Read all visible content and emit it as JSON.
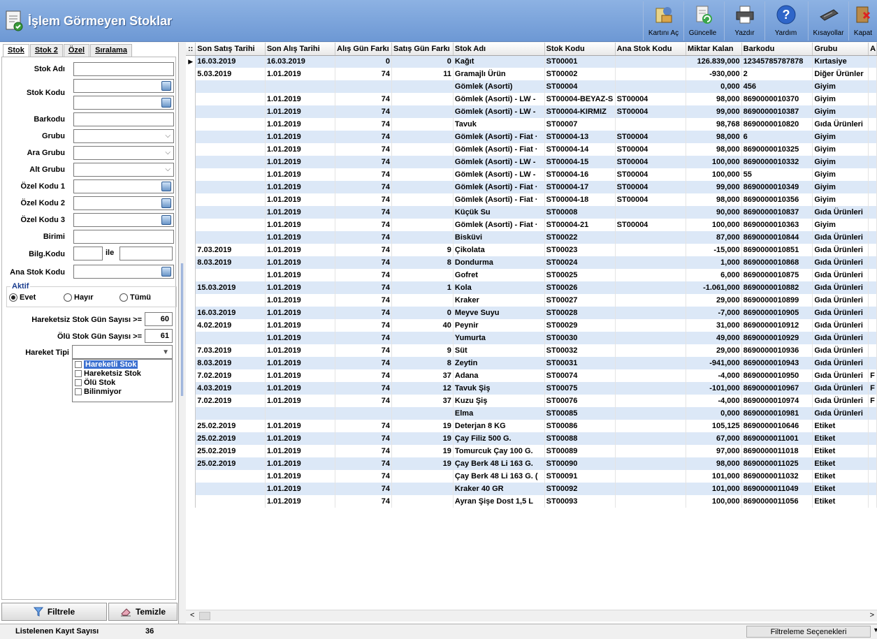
{
  "window": {
    "title": "İşlem Görmeyen Stoklar"
  },
  "toolbar": [
    {
      "label": "Kartını Aç",
      "icon": "card-open-icon"
    },
    {
      "label": "Güncelle",
      "icon": "refresh-icon"
    },
    {
      "label": "Yazdır",
      "icon": "printer-icon"
    },
    {
      "label": "Yardım",
      "icon": "help-icon"
    },
    {
      "label": "Kısayollar",
      "icon": "keyboard-icon"
    },
    {
      "label": "Kapat",
      "icon": "exit-icon"
    }
  ],
  "tabs": [
    "Stok",
    "Stok 2",
    "Özel",
    "Sıralama"
  ],
  "filters": {
    "stok_adi": "Stok Adı",
    "stok_kodu": "Stok Kodu",
    "barkodu": "Barkodu",
    "grubu": "Grubu",
    "ara_grubu": "Ara Grubu",
    "alt_grubu": "Alt Grubu",
    "ozel1": "Özel Kodu 1",
    "ozel2": "Özel Kodu 2",
    "ozel3": "Özel Kodu 3",
    "birimi": "Birimi",
    "bilg_kodu": "Bilg.Kodu",
    "ile": "ile",
    "ana_stok": "Ana Stok Kodu",
    "aktif": "Aktif",
    "evet": "Evet",
    "hayir": "Hayır",
    "tumu": "Tümü",
    "hareketsiz_label": "Hareketsiz Stok Gün Sayısı >=",
    "hareketsiz_value": "60",
    "olu_label": "Ölü Stok Gün Sayısı >=",
    "olu_value": "61",
    "hareket_tipi": "Hareket Tipi",
    "hareket_options": [
      "Hareketli Stok",
      "Hareketsiz Stok",
      "Ölü Stok",
      "Bilinmiyor"
    ]
  },
  "buttons": {
    "filtrele": "Filtrele",
    "temizle": "Temizle"
  },
  "grid": {
    "columns": [
      "Son Satış Tarihi",
      "Son Alış Tarihi",
      "Alış Gün Farkı",
      "Satış Gün Farkı",
      "Stok Adı",
      "Stok Kodu",
      "Ana Stok Kodu",
      "Miktar Kalan",
      "Barkodu",
      "Grubu",
      "A"
    ],
    "rows": [
      [
        "16.03.2019",
        "16.03.2019",
        "0",
        "0",
        "Kağıt",
        "ST00001",
        "",
        "126.839,000",
        "12345785787878",
        "Kırtasiye",
        ""
      ],
      [
        "5.03.2019",
        "1.01.2019",
        "74",
        "11",
        "Gramajlı Ürün",
        "ST00002",
        "",
        "-930,000",
        "2",
        "Diğer Ürünler",
        ""
      ],
      [
        "",
        "",
        "",
        "",
        "Gömlek (Asorti)",
        "ST00004",
        "",
        "0,000",
        "456",
        "Giyim",
        ""
      ],
      [
        "",
        "1.01.2019",
        "74",
        "",
        "Gömlek (Asorti) - LW -",
        "ST00004-BEYAZ-S",
        "ST00004",
        "98,000",
        "8690000010370",
        "Giyim",
        ""
      ],
      [
        "",
        "1.01.2019",
        "74",
        "",
        "Gömlek (Asorti) - LW -",
        "ST00004-KIRMIZ",
        "ST00004",
        "99,000",
        "8690000010387",
        "Giyim",
        ""
      ],
      [
        "",
        "1.01.2019",
        "74",
        "",
        "Tavuk",
        "ST00007",
        "",
        "98,768",
        "8690000010820",
        "Gıda Ürünleri",
        ""
      ],
      [
        "",
        "1.01.2019",
        "74",
        "",
        "Gömlek (Asorti) - Fiat ·",
        "ST00004-13",
        "ST00004",
        "98,000",
        "6",
        "Giyim",
        ""
      ],
      [
        "",
        "1.01.2019",
        "74",
        "",
        "Gömlek (Asorti) - Fiat ·",
        "ST00004-14",
        "ST00004",
        "98,000",
        "8690000010325",
        "Giyim",
        ""
      ],
      [
        "",
        "1.01.2019",
        "74",
        "",
        "Gömlek (Asorti) - LW -",
        "ST00004-15",
        "ST00004",
        "100,000",
        "8690000010332",
        "Giyim",
        ""
      ],
      [
        "",
        "1.01.2019",
        "74",
        "",
        "Gömlek (Asorti) - LW -",
        "ST00004-16",
        "ST00004",
        "100,000",
        "55",
        "Giyim",
        ""
      ],
      [
        "",
        "1.01.2019",
        "74",
        "",
        "Gömlek (Asorti) - Fiat ·",
        "ST00004-17",
        "ST00004",
        "99,000",
        "8690000010349",
        "Giyim",
        ""
      ],
      [
        "",
        "1.01.2019",
        "74",
        "",
        "Gömlek (Asorti) - Fiat ·",
        "ST00004-18",
        "ST00004",
        "98,000",
        "8690000010356",
        "Giyim",
        ""
      ],
      [
        "",
        "1.01.2019",
        "74",
        "",
        "Küçük Su",
        "ST00008",
        "",
        "90,000",
        "8690000010837",
        "Gıda Ürünleri",
        ""
      ],
      [
        "",
        "1.01.2019",
        "74",
        "",
        "Gömlek (Asorti) - Fiat ·",
        "ST00004-21",
        "ST00004",
        "100,000",
        "8690000010363",
        "Giyim",
        ""
      ],
      [
        "",
        "1.01.2019",
        "74",
        "",
        "Bisküvi",
        "ST00022",
        "",
        "87,000",
        "8690000010844",
        "Gıda Ürünleri",
        ""
      ],
      [
        "7.03.2019",
        "1.01.2019",
        "74",
        "9",
        "Çikolata",
        "ST00023",
        "",
        "-15,000",
        "8690000010851",
        "Gıda Ürünleri",
        ""
      ],
      [
        "8.03.2019",
        "1.01.2019",
        "74",
        "8",
        "Dondurma",
        "ST00024",
        "",
        "1,000",
        "8690000010868",
        "Gıda Ürünleri",
        ""
      ],
      [
        "",
        "1.01.2019",
        "74",
        "",
        "Gofret",
        "ST00025",
        "",
        "6,000",
        "8690000010875",
        "Gıda Ürünleri",
        ""
      ],
      [
        "15.03.2019",
        "1.01.2019",
        "74",
        "1",
        "Kola",
        "ST00026",
        "",
        "-1.061,000",
        "8690000010882",
        "Gıda Ürünleri",
        ""
      ],
      [
        "",
        "1.01.2019",
        "74",
        "",
        "Kraker",
        "ST00027",
        "",
        "29,000",
        "8690000010899",
        "Gıda Ürünleri",
        ""
      ],
      [
        "16.03.2019",
        "1.01.2019",
        "74",
        "0",
        "Meyve Suyu",
        "ST00028",
        "",
        "-7,000",
        "8690000010905",
        "Gıda Ürünleri",
        ""
      ],
      [
        "4.02.2019",
        "1.01.2019",
        "74",
        "40",
        "Peynir",
        "ST00029",
        "",
        "31,000",
        "8690000010912",
        "Gıda Ürünleri",
        ""
      ],
      [
        "",
        "1.01.2019",
        "74",
        "",
        "Yumurta",
        "ST00030",
        "",
        "49,000",
        "8690000010929",
        "Gıda Ürünleri",
        ""
      ],
      [
        "7.03.2019",
        "1.01.2019",
        "74",
        "9",
        "Süt",
        "ST00032",
        "",
        "29,000",
        "8690000010936",
        "Gıda Ürünleri",
        ""
      ],
      [
        "8.03.2019",
        "1.01.2019",
        "74",
        "8",
        "Zeytin",
        "ST00031",
        "",
        "-941,000",
        "8690000010943",
        "Gıda Ürünleri",
        ""
      ],
      [
        "7.02.2019",
        "1.01.2019",
        "74",
        "37",
        "Adana",
        "ST00074",
        "",
        "-4,000",
        "8690000010950",
        "Gıda Ürünleri",
        "F"
      ],
      [
        "4.03.2019",
        "1.01.2019",
        "74",
        "12",
        "Tavuk Şiş",
        "ST00075",
        "",
        "-101,000",
        "8690000010967",
        "Gıda Ürünleri",
        "F"
      ],
      [
        "7.02.2019",
        "1.01.2019",
        "74",
        "37",
        "Kuzu Şiş",
        "ST00076",
        "",
        "-4,000",
        "8690000010974",
        "Gıda Ürünleri",
        "F"
      ],
      [
        "",
        "",
        "",
        "",
        "Elma",
        "ST00085",
        "",
        "0,000",
        "8690000010981",
        "Gıda Ürünleri",
        ""
      ],
      [
        "25.02.2019",
        "1.01.2019",
        "74",
        "19",
        "Deterjan 8 KG",
        "ST00086",
        "",
        "105,125",
        "8690000010646",
        "Etiket",
        ""
      ],
      [
        "25.02.2019",
        "1.01.2019",
        "74",
        "19",
        "Çay Filiz 500 G.",
        "ST00088",
        "",
        "67,000",
        "8690000011001",
        "Etiket",
        ""
      ],
      [
        "25.02.2019",
        "1.01.2019",
        "74",
        "19",
        "Tomurcuk Çay 100 G.",
        "ST00089",
        "",
        "97,000",
        "8690000011018",
        "Etiket",
        ""
      ],
      [
        "25.02.2019",
        "1.01.2019",
        "74",
        "19",
        "Çay Berk 48 Li 163 G.",
        "ST00090",
        "",
        "98,000",
        "8690000011025",
        "Etiket",
        ""
      ],
      [
        "",
        "1.01.2019",
        "74",
        "",
        "Çay Berk 48 Li 163 G. (",
        "ST00091",
        "",
        "101,000",
        "8690000011032",
        "Etiket",
        ""
      ],
      [
        "",
        "1.01.2019",
        "74",
        "",
        "Kraker 40 GR",
        "ST00092",
        "",
        "101,000",
        "8690000011049",
        "Etiket",
        ""
      ],
      [
        "",
        "1.01.2019",
        "74",
        "",
        "Ayran Şişe Dost 1,5 L",
        "ST00093",
        "",
        "100,000",
        "8690000011056",
        "Etiket",
        ""
      ]
    ]
  },
  "status": {
    "label": "Listelenen Kayıt Sayısı",
    "count": "36",
    "options": "Filtreleme Seçenekleri"
  }
}
